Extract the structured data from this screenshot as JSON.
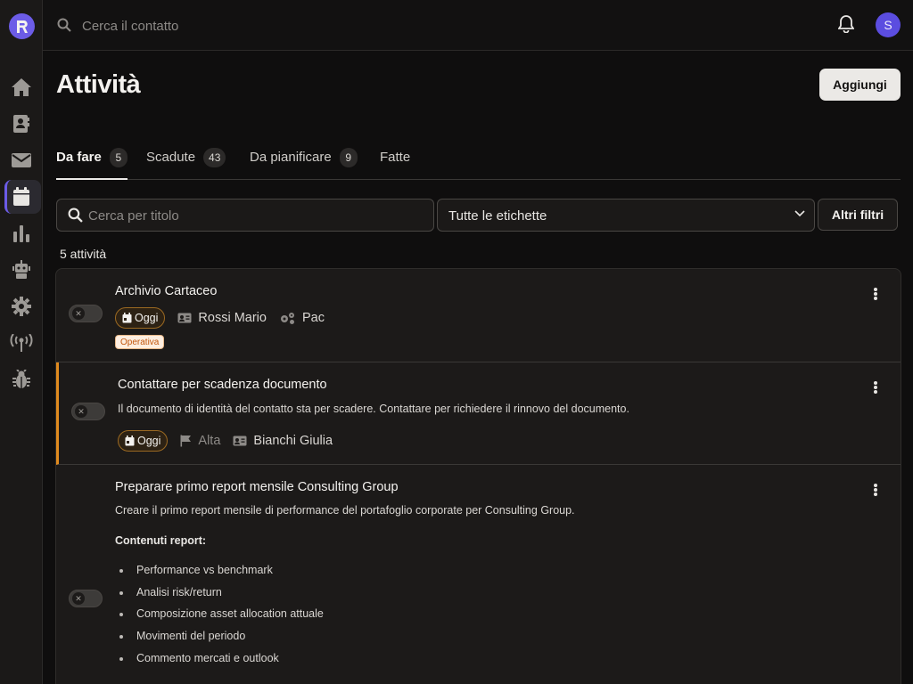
{
  "topbar": {
    "search_placeholder": "Cerca il contatto",
    "avatar_initial": "S"
  },
  "page": {
    "title": "Attività",
    "add_label": "Aggiungi"
  },
  "tabs": [
    {
      "label": "Da fare",
      "count": "5"
    },
    {
      "label": "Scadute",
      "count": "43"
    },
    {
      "label": "Da pianificare",
      "count": "9"
    },
    {
      "label": "Fatte"
    }
  ],
  "filters": {
    "search_placeholder": "Cerca per titolo",
    "labels_value": "Tutte le etichette",
    "more_label": "Altri filtri"
  },
  "list": {
    "count_text": "5 attività"
  },
  "tasks": [
    {
      "title": "Archivio Cartaceo",
      "due": "Oggi",
      "contact": "Rossi Mario",
      "category": "Pac",
      "tag": "Operativa"
    },
    {
      "title": "Contattare per scadenza documento",
      "description": "Il documento di identità del contatto sta per scadere. Contattare per richiedere il rinnovo del documento.",
      "due": "Oggi",
      "priority": "Alta",
      "contact": "Bianchi Giulia"
    },
    {
      "title": "Preparare primo report mensile Consulting Group",
      "description": "Creare il primo report mensile di performance del portafoglio corporate per Consulting Group.",
      "section_heading": "Contenuti report:",
      "items": [
        "Performance vs benchmark",
        "Analisi risk/return",
        "Composizione asset allocation attuale",
        "Movimenti del periodo",
        "Commento mercati e outlook"
      ]
    }
  ],
  "colors": {
    "accent": "#6c5ce7",
    "warning": "#e08a1e"
  }
}
